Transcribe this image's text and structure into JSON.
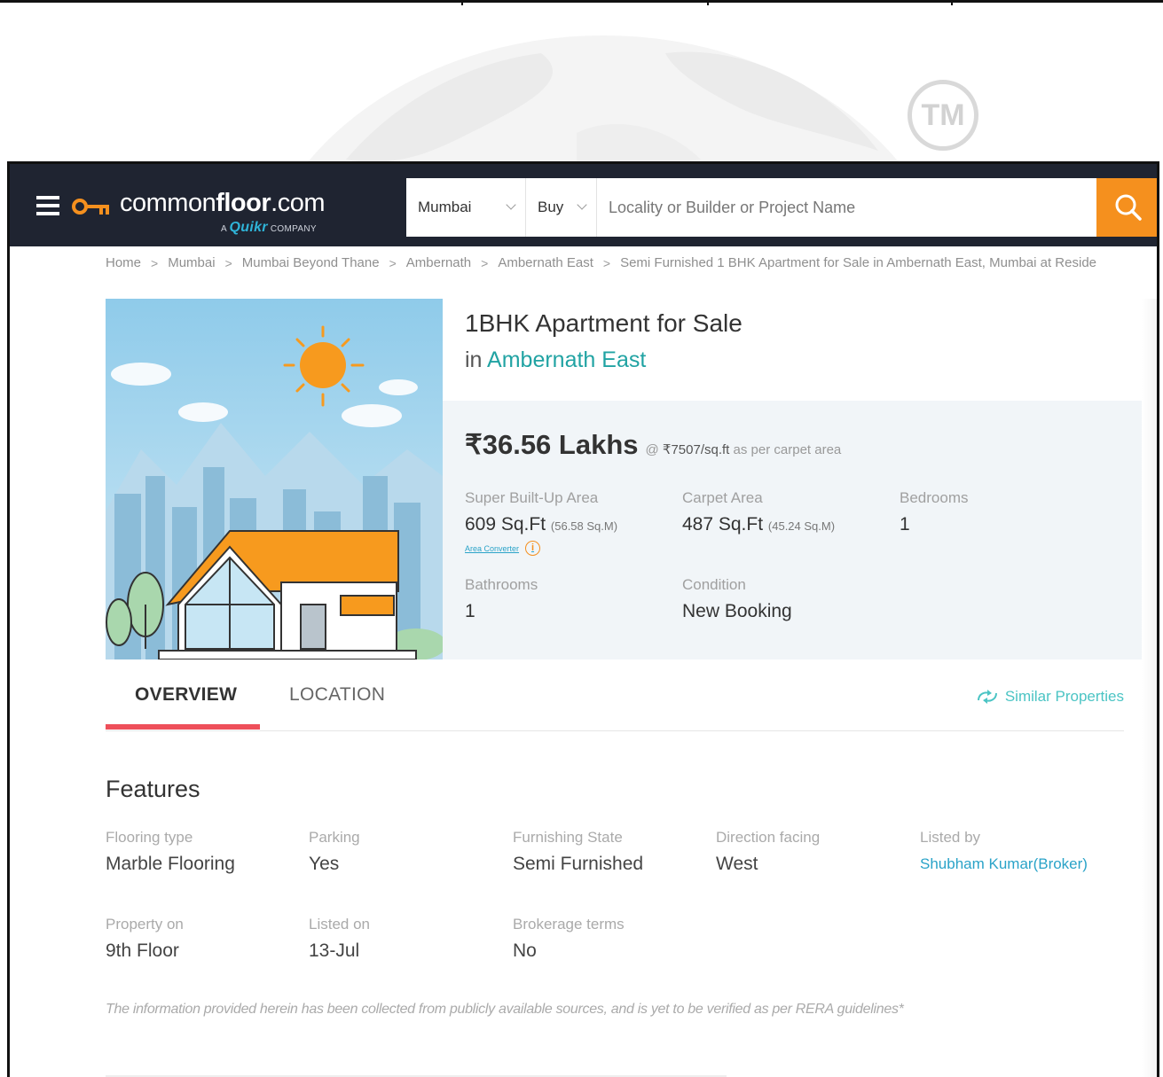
{
  "watermark": {
    "tm": "TM"
  },
  "header": {
    "logo": {
      "name_light": "common",
      "name_bold": "floor",
      "name_suffix": ".com",
      "sub_prefix": "A",
      "sub_brand": "Quikr",
      "sub_suffix": "COMPANY"
    },
    "search": {
      "city": "Mumbai",
      "type": "Buy",
      "placeholder": "Locality or Builder or Project Name"
    },
    "accent_color": "#f5901e"
  },
  "breadcrumb": [
    "Home",
    "Mumbai",
    "Mumbai Beyond Thane",
    "Ambernath",
    "Ambernath East",
    "Semi Furnished 1 BHK Apartment for Sale in Ambernath East, Mumbai at Reside"
  ],
  "property": {
    "title": "1BHK Apartment for Sale",
    "locality_prefix": "in",
    "locality": "Ambernath East",
    "price": "₹36.56 Lakhs",
    "price_at": "@",
    "rate": "₹7507/sq.ft",
    "rate_note": "as per carpet area",
    "specs": {
      "super_area": {
        "label": "Super Built-Up Area",
        "value": "609 Sq.Ft",
        "sub": "(56.58 Sq.M)"
      },
      "area_converter": "Area Converter",
      "carpet_area": {
        "label": "Carpet Area",
        "value": "487 Sq.Ft",
        "sub": "(45.24 Sq.M)"
      },
      "bedrooms": {
        "label": "Bedrooms",
        "value": "1"
      },
      "bathrooms": {
        "label": "Bathrooms",
        "value": "1"
      },
      "condition": {
        "label": "Condition",
        "value": "New Booking"
      }
    }
  },
  "tabs": {
    "overview": "OVERVIEW",
    "location": "LOCATION",
    "similar": "Similar Properties",
    "active": "overview"
  },
  "features": {
    "title": "Features",
    "items": [
      {
        "label": "Flooring type",
        "value": "Marble Flooring"
      },
      {
        "label": "Parking",
        "value": "Yes"
      },
      {
        "label": "Furnishing State",
        "value": "Semi Furnished"
      },
      {
        "label": "Direction facing",
        "value": "West"
      },
      {
        "label": "Listed by",
        "value": "Shubham Kumar(Broker)"
      },
      {
        "label": "Property on",
        "value": "9th Floor"
      },
      {
        "label": "Listed on",
        "value": "13-Jul"
      },
      {
        "label": "Brokerage terms",
        "value": "No"
      }
    ],
    "disclaimer": "The information provided herein has been collected from publicly available sources, and is yet to be verified as per RERA guidelines*"
  }
}
